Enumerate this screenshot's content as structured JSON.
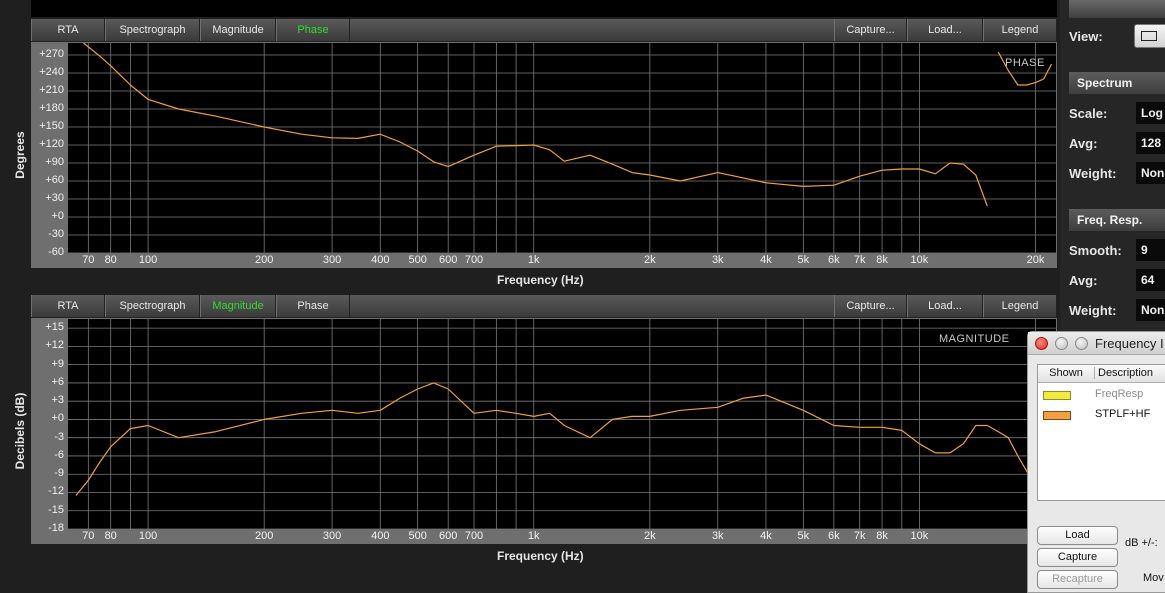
{
  "toolbar": {
    "rta": "RTA",
    "spectrograph": "Spectrograph",
    "magnitude": "Magnitude",
    "phase": "Phase",
    "capture": "Capture...",
    "load": "Load...",
    "legend": "Legend"
  },
  "colors": {
    "active_tab": "#2fdc2f",
    "trace": "#f0a040",
    "plot_bg": "#000000",
    "grid": "#7a7a7a"
  },
  "phase_panel": {
    "active_tab": "Phase",
    "corner_label": "PHASE",
    "ylabel": "Degrees",
    "xlabel": "Frequency (Hz)",
    "y_ticks": [
      "+270",
      "+240",
      "+210",
      "+180",
      "+150",
      "+120",
      "+90",
      "+60",
      "+30",
      "+0",
      "-30",
      "-60"
    ],
    "x_ticks": [
      "70",
      "80",
      "100",
      "200",
      "300",
      "400",
      "500",
      "600",
      "700",
      "1k",
      "2k",
      "3k",
      "4k",
      "5k",
      "6k",
      "7k",
      "8k",
      "10k",
      "20k"
    ]
  },
  "magnitude_panel": {
    "active_tab": "Magnitude",
    "corner_label": "MAGNITUDE",
    "ylabel": "Decibels (dB)",
    "xlabel": "Frequency (Hz)",
    "y_ticks": [
      "+15",
      "+12",
      "+9",
      "+6",
      "+3",
      "+0",
      "-3",
      "-6",
      "-9",
      "-12",
      "-15",
      "-18"
    ],
    "x_ticks": [
      "70",
      "80",
      "100",
      "200",
      "300",
      "400",
      "500",
      "600",
      "700",
      "1k",
      "2k",
      "3k",
      "4k",
      "5k",
      "6k",
      "7k",
      "8k",
      "10k",
      "20k"
    ]
  },
  "chart_data": [
    {
      "type": "line",
      "ylabel": "Degrees",
      "xlabel": "Frequency (Hz)",
      "x_scale": "log",
      "ylim": [
        -60,
        290
      ],
      "grid": true,
      "series": [
        {
          "name": "STPLF+HF",
          "x": [
            68,
            75,
            80,
            90,
            100,
            120,
            150,
            200,
            250,
            300,
            350,
            400,
            450,
            500,
            550,
            600,
            700,
            800,
            900,
            1000,
            1100,
            1200,
            1400,
            1600,
            1800,
            2000,
            2400,
            3000,
            4000,
            5000,
            6000,
            7000,
            8000,
            9000,
            10000,
            11000,
            12000,
            13000,
            14000,
            15000
          ],
          "y": [
            290,
            268,
            252,
            220,
            196,
            180,
            168,
            150,
            138,
            132,
            131,
            138,
            125,
            110,
            92,
            84,
            103,
            118,
            119,
            120,
            112,
            93,
            103,
            88,
            74,
            70,
            60,
            74,
            57,
            51,
            53,
            68,
            78,
            80,
            80,
            72,
            90,
            88,
            70,
            18
          ]
        },
        {
          "name": "",
          "x": [
            16000,
            17000,
            18000,
            19000,
            20000,
            21000,
            22000
          ],
          "y": [
            275,
            244,
            220,
            220,
            224,
            230,
            255
          ]
        }
      ]
    },
    {
      "type": "line",
      "ylabel": "Decibels (dB)",
      "xlabel": "Frequency (Hz)",
      "x_scale": "log",
      "ylim": [
        -18,
        16.5
      ],
      "grid": true,
      "series": [
        {
          "name": "STPLF+HF",
          "x": [
            65,
            70,
            75,
            80,
            90,
            100,
            120,
            150,
            200,
            250,
            300,
            350,
            400,
            450,
            500,
            550,
            600,
            700,
            800,
            900,
            1000,
            1100,
            1200,
            1400,
            1600,
            1800,
            2000,
            2400,
            3000,
            3500,
            4000,
            5000,
            6000,
            7000,
            8000,
            9000,
            10000,
            11000,
            12000,
            13000,
            14000,
            15000,
            16000,
            17000,
            18000,
            20000,
            22000
          ],
          "y": [
            -12.5,
            -10,
            -7,
            -4.5,
            -1.5,
            -1,
            -3,
            -2,
            0,
            1,
            1.5,
            1,
            1.5,
            3.5,
            5,
            6,
            5,
            1,
            1.5,
            1,
            0.5,
            1,
            -1,
            -3,
            0,
            0.5,
            0.5,
            1.5,
            2,
            3.5,
            4,
            1.5,
            -1,
            -1.3,
            -1.3,
            -1.8,
            -4,
            -5.5,
            -5.5,
            -4,
            -1,
            -1,
            -2,
            -3,
            -6,
            -11,
            -16
          ]
        }
      ]
    }
  ],
  "right_panel": {
    "view_label": "View:",
    "spectrum_header": "Spectrum",
    "scale_label": "Scale:",
    "scale_value": "Log",
    "avg_label": "Avg:",
    "avg_value": "128",
    "weight_label": "Weight:",
    "weight_value": "Non",
    "freq_resp_header": "Freq. Resp.",
    "smooth_label": "Smooth:",
    "smooth_value": "9",
    "avg2_label": "Avg:",
    "avg2_value": "64",
    "weight2_label": "Weight:",
    "weight2_value": "Non"
  },
  "dialog": {
    "title": "Frequency I",
    "col_shown": "Shown",
    "col_description": "Description",
    "rows": [
      {
        "description": "FreqResp",
        "color": "#f4ec3a"
      },
      {
        "description": "STPLF+HF",
        "color": "#f4a040"
      }
    ],
    "load_label": "Load",
    "capture_label": "Capture",
    "recapture_label": "Recapture",
    "db_label": "dB +/-:",
    "move_label": "Mov"
  }
}
